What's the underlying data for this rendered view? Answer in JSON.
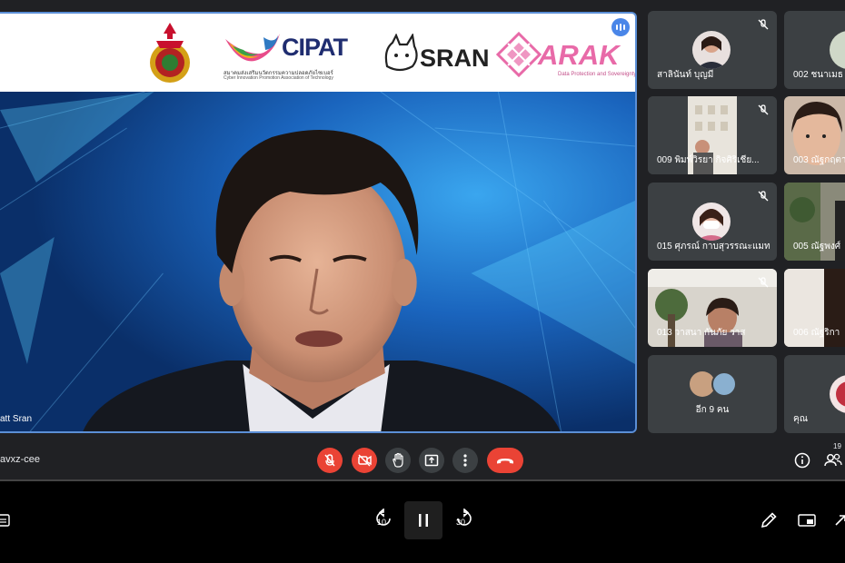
{
  "main": {
    "speaker_name": "att Sran",
    "logos": {
      "cipat": "CIPAT",
      "cipat_sub_th": "สมาคมส่งเสริมนวัตกรรมความปลอดภัยไซเบอร์",
      "cipat_sub_en": "Cyber Innovation Promotion Association of Technology",
      "sran": "SRAN",
      "arak": "ARAK",
      "arak_sub": "Data Protection and Sovereignty"
    }
  },
  "participants": [
    {
      "name": "สาลินันท์ บุญมี"
    },
    {
      "name": "002 ชนาเมธ ว"
    },
    {
      "name": "009 พิมพ์วิรยา กิจศิริเชีย..."
    },
    {
      "name": "003 ณัฐกฤตา"
    },
    {
      "name": "015 ศุภรณ์ กาบสุวรรณะแมท"
    },
    {
      "name": "005 ณัฐพงศ์"
    },
    {
      "name": "013 วาสนา กันภัย วาส"
    },
    {
      "name": "006 ณัฐริกา"
    },
    {
      "name": "อีก 9 คน"
    },
    {
      "name": "คุณ"
    }
  ],
  "meeting": {
    "code": "avxz-cee",
    "participant_count": "19"
  },
  "player": {
    "rewind_label": "10",
    "forward_label": "30"
  }
}
